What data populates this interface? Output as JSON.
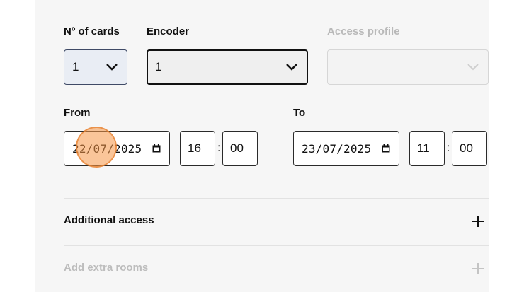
{
  "form": {
    "cards": {
      "label": "Nº of cards",
      "value": "1"
    },
    "encoder": {
      "label": "Encoder",
      "value": "1"
    },
    "access_profile": {
      "label": "Access profile",
      "value": ""
    },
    "from": {
      "label": "From",
      "date": "22/07/2025",
      "hour": "16",
      "minute": "00"
    },
    "to": {
      "label": "To",
      "date": "23/07/2025",
      "hour": "11",
      "minute": "00"
    },
    "time_separator": ":"
  },
  "sections": {
    "additional_access": "Additional access",
    "add_extra_rooms": "Add extra rooms"
  },
  "icons": {
    "select_caret": "chevron-down-icon",
    "date_picker": "calendar-icon",
    "expand": "plus-icon"
  },
  "colors": {
    "panel_bg": "#f6f6f6",
    "cards_select_bg": "#e9edf4",
    "disabled_text": "#b9b9b9",
    "cursor_highlight": "#f59646"
  }
}
